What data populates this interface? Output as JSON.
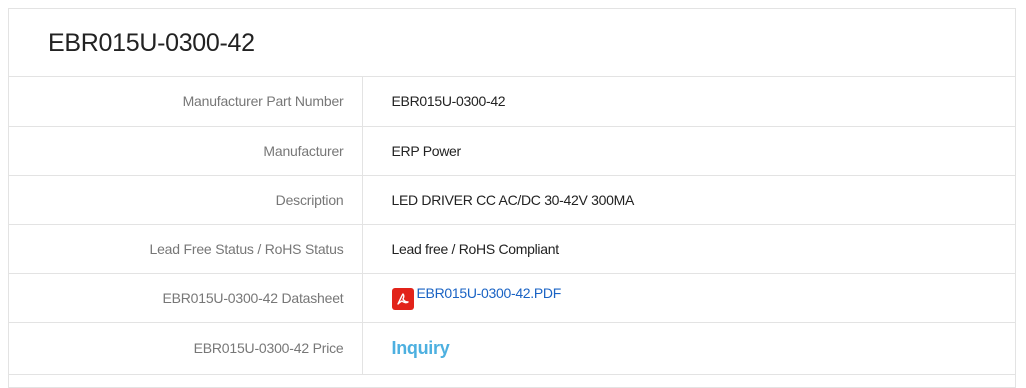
{
  "title": "EBR015U-0300-42",
  "rows": [
    {
      "label": "Manufacturer Part Number",
      "value": "EBR015U-0300-42"
    },
    {
      "label": "Manufacturer",
      "value": "ERP Power"
    },
    {
      "label": "Description",
      "value": "LED DRIVER CC AC/DC 30-42V 300MA"
    },
    {
      "label": "Lead Free Status / RoHS Status",
      "value": "Lead free / RoHS Compliant"
    },
    {
      "label": "EBR015U-0300-42 Datasheet",
      "value": "EBR015U-0300-42.PDF",
      "icon": "pdf-icon"
    },
    {
      "label": "EBR015U-0300-42 Price",
      "value": "Inquiry"
    }
  ],
  "colors": {
    "link": "#1a63c4",
    "inquiry": "#4db0e0",
    "pdf_icon": "#e2231a"
  }
}
